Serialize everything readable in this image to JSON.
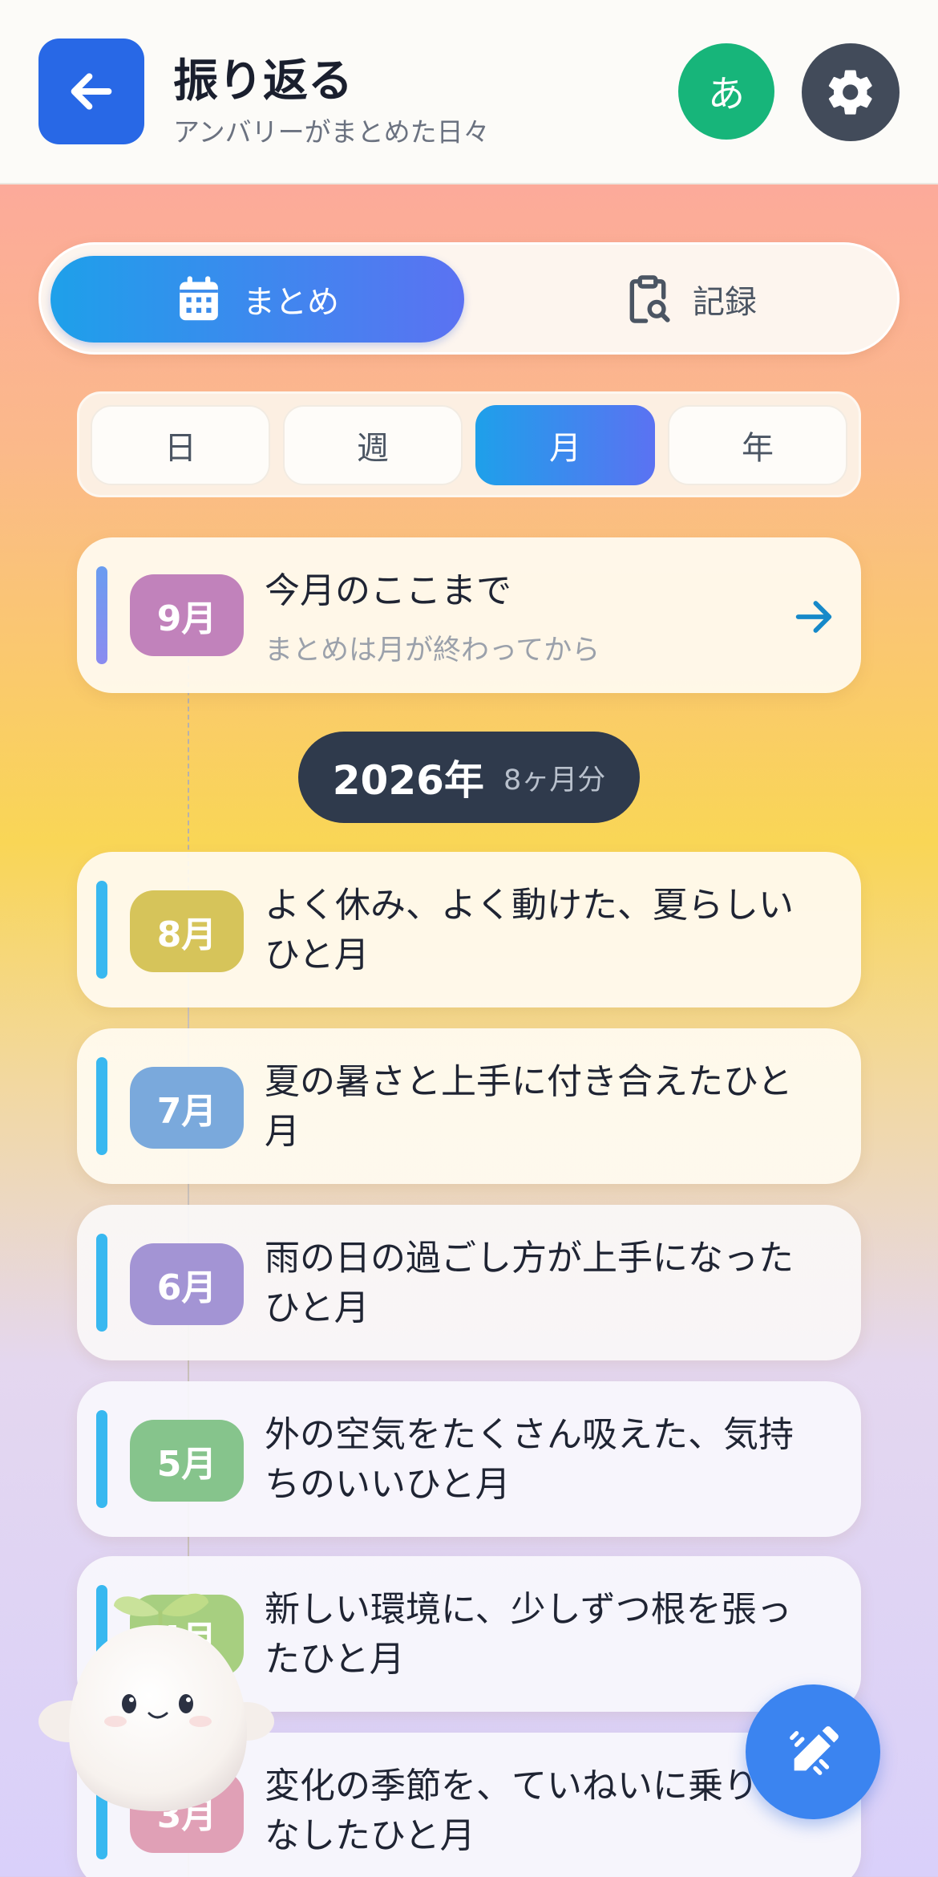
{
  "header": {
    "title": "振り返る",
    "subtitle": "アンバリーがまとめた日々",
    "language_label": "あ",
    "back_icon": "arrow-left-icon",
    "settings_icon": "gear-icon"
  },
  "main_tabs": [
    {
      "label": "まとめ",
      "icon": "calendar-icon",
      "active": true
    },
    {
      "label": "記録",
      "icon": "clipboard-search-icon",
      "active": false
    }
  ],
  "period_tabs": [
    {
      "label": "日",
      "active": false
    },
    {
      "label": "週",
      "active": false
    },
    {
      "label": "月",
      "active": true
    },
    {
      "label": "年",
      "active": false
    }
  ],
  "current_month": {
    "badge": "9月",
    "title": "今月のここまで",
    "note": "まとめは月が終わってから",
    "icon": "arrow-right-icon"
  },
  "year_divider": {
    "year": "2026年",
    "count": "8ヶ月分"
  },
  "months": [
    {
      "badge": "8月",
      "text": "よく休み、よく動けた、夏らしいひと月",
      "color": "#d6c45a"
    },
    {
      "badge": "7月",
      "text": "夏の暑さと上手に付き合えたひと月",
      "color": "#7aa9dc"
    },
    {
      "badge": "6月",
      "text": "雨の日の過ごし方が上手になったひと月",
      "color": "#a394d4"
    },
    {
      "badge": "5月",
      "text": "外の空気をたくさん吸えた、気持ちのいいひと月",
      "color": "#86c48c"
    },
    {
      "badge": "4月",
      "text": "新しい環境に、少しずつ根を張ったひと月",
      "color": "#a7cf80"
    },
    {
      "badge": "3月",
      "text": "変化の季節を、ていねいに乗りこなしたひと月",
      "color": "#e0a0b6"
    }
  ],
  "fab": {
    "icon": "pencil-edit-icon"
  },
  "colors": {
    "accent_blue": "#2868e6",
    "current_badge": "#c182bb",
    "language_button": "#17b57a",
    "timeline_bar": "#38b8f0"
  }
}
